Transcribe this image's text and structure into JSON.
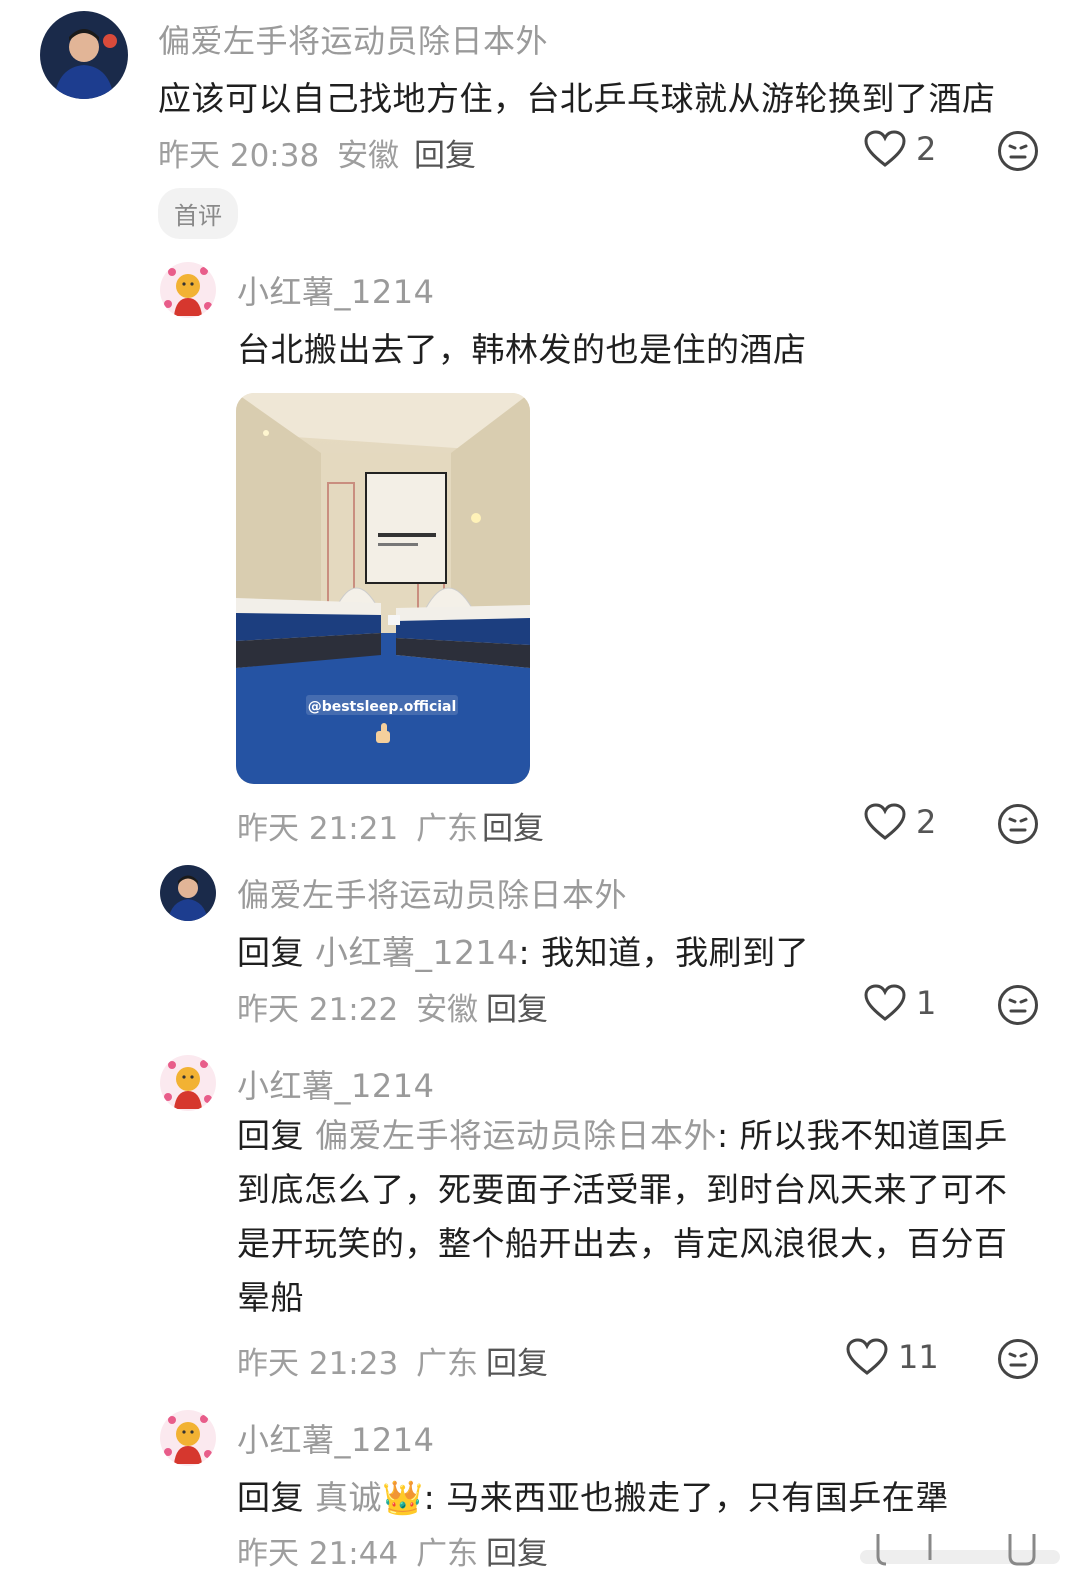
{
  "comments": [
    {
      "user": "偏爱左手将运动员除日本外",
      "text": "应该可以自己找地方住，台北乒乓球就从游轮换到了酒店",
      "time": "昨天 20:38",
      "location": "安徽",
      "reply": "回复",
      "likes": "2",
      "tag": "首评"
    },
    {
      "user": "小红薯_1214",
      "text": "台北搬出去了，韩林发的也是住的酒店",
      "image_watermark": "@bestsleep.official",
      "time": "昨天 21:21",
      "location": "广东",
      "reply": "回复",
      "likes": "2"
    },
    {
      "user": "偏爱左手将运动员除日本外",
      "reply_prefix": "回复",
      "mention": "小红薯_1214",
      "text": ": 我知道，我刷到了",
      "time": "昨天 21:22",
      "location": "安徽",
      "reply": "回复",
      "likes": "1"
    },
    {
      "user": "小红薯_1214",
      "reply_prefix": "回复",
      "mention": "偏爱左手将运动员除日本外",
      "text": ": 所以我不知道国乒到底怎么了，死要面子活受罪，到时台风天来了可不是开玩笑的，整个船开出去，肯定风浪很大，百分百晕船",
      "time": "昨天 21:23",
      "location": "广东",
      "reply": "回复",
      "likes": "11"
    },
    {
      "user": "小红薯_1214",
      "reply_prefix": "回复",
      "mention": "真诚👑",
      "text": ": 马来西亚也搬走了，只有国乒在犟",
      "time": "昨天 21:44",
      "location": "广东",
      "reply": "回复"
    }
  ],
  "icons": {
    "like": "heart-outline-icon",
    "emoji": "neutral-face-icon"
  },
  "colors": {
    "meta": "#9e9e9e",
    "username": "#9a9a9a",
    "text": "#1f1f1f",
    "carpet": "#1f4f9a"
  }
}
